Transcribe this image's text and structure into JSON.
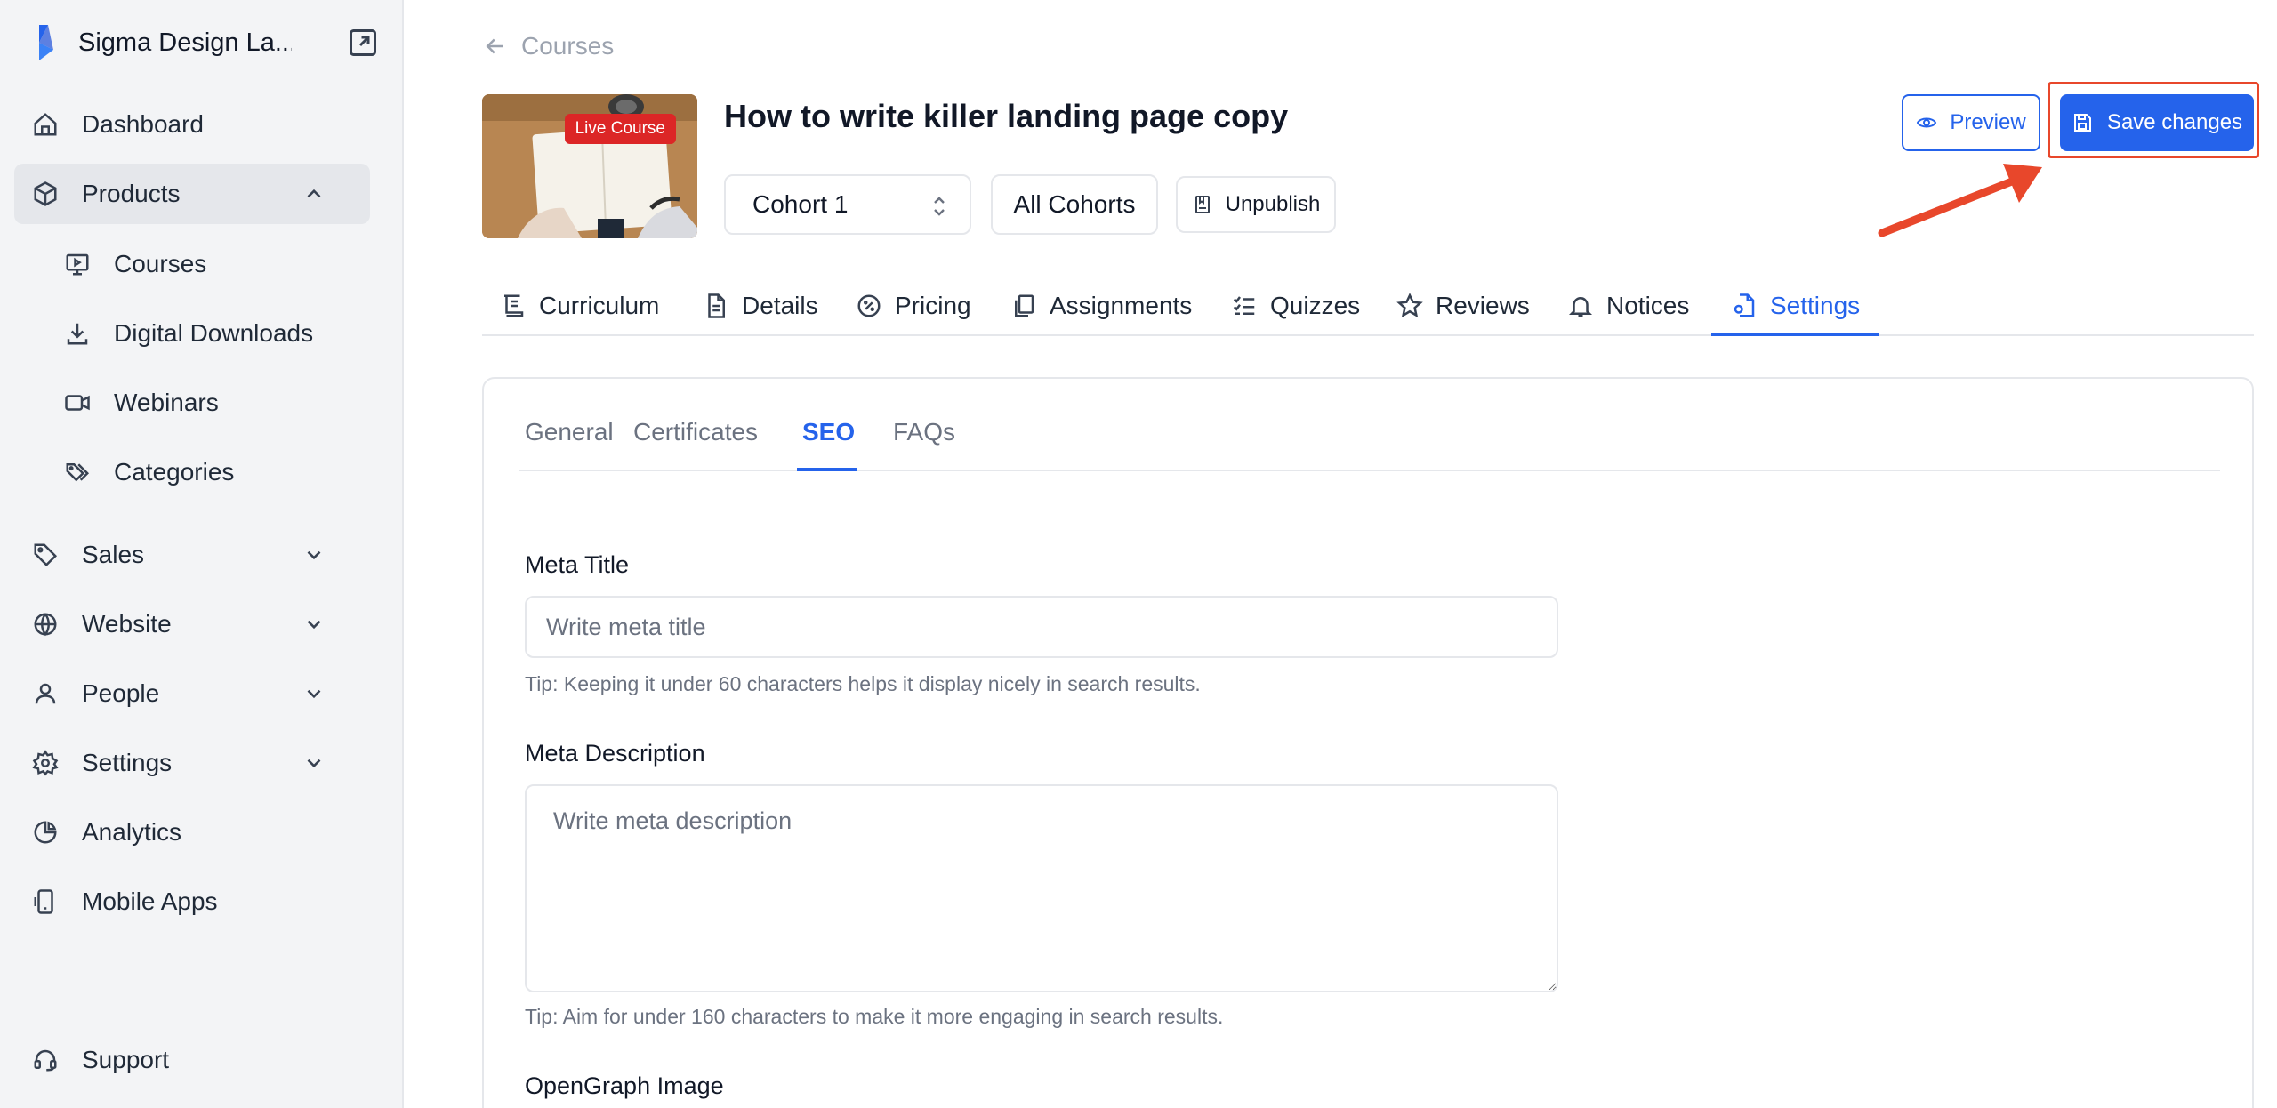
{
  "sidebar": {
    "brand_name": "Sigma Design La...",
    "items": [
      {
        "label": "Dashboard"
      },
      {
        "label": "Products"
      },
      {
        "label": "Sales"
      },
      {
        "label": "Website"
      },
      {
        "label": "People"
      },
      {
        "label": "Settings"
      },
      {
        "label": "Analytics"
      },
      {
        "label": "Mobile Apps"
      }
    ],
    "product_sub_items": [
      {
        "label": "Courses"
      },
      {
        "label": "Digital Downloads"
      },
      {
        "label": "Webinars"
      },
      {
        "label": "Categories"
      }
    ],
    "support_label": "Support"
  },
  "breadcrumb": {
    "label": "Courses"
  },
  "course": {
    "badge": "Live Course",
    "title": "How to write killer landing page copy"
  },
  "controls": {
    "cohort_selected": "Cohort 1",
    "all_cohorts": "All Cohorts",
    "unpublish": "Unpublish",
    "preview": "Preview",
    "save": "Save changes"
  },
  "tabs": [
    {
      "label": "Curriculum"
    },
    {
      "label": "Details"
    },
    {
      "label": "Pricing"
    },
    {
      "label": "Assignments"
    },
    {
      "label": "Quizzes"
    },
    {
      "label": "Reviews"
    },
    {
      "label": "Notices"
    },
    {
      "label": "Settings"
    }
  ],
  "subtabs": [
    {
      "label": "General"
    },
    {
      "label": "Certificates"
    },
    {
      "label": "SEO"
    },
    {
      "label": "FAQs"
    }
  ],
  "seo": {
    "meta_title_label": "Meta Title",
    "meta_title_placeholder": "Write meta title",
    "meta_title_value": "",
    "meta_title_tip": "Tip: Keeping it under 60 characters helps it display nicely in search results.",
    "meta_desc_label": "Meta Description",
    "meta_desc_placeholder": "Write meta description",
    "meta_desc_value": "",
    "meta_desc_tip": "Tip: Aim for under 160 characters to make it more engaging in search results.",
    "og_image_label": "OpenGraph Image"
  },
  "colors": {
    "accent": "#2563eb",
    "badge": "#dc2626",
    "annotation": "#e8472b",
    "sidebar_bg": "#f3f4f6"
  }
}
